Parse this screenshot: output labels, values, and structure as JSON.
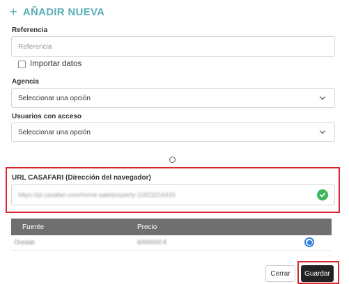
{
  "header": {
    "icon": "plus-icon",
    "title": "AÑADIR NUEVA"
  },
  "form": {
    "referencia": {
      "label": "Referencia",
      "placeholder": "Referencia"
    },
    "importar": {
      "label": "Importar datos",
      "checked": false
    },
    "agencia": {
      "label": "Agencia",
      "value": "Seleccionar una opción"
    },
    "usuarios": {
      "label": "Usuarios con acceso",
      "value": "Seleccionar una opción"
    },
    "url": {
      "label": "URL CASAFARI (Dirección del navegador)",
      "value": "https://pt.casafari.com/home-sale/property-11823216433",
      "status_icon": "check-circle-icon",
      "status_color": "#3eb75a"
    }
  },
  "table": {
    "columns": [
      "Fuente",
      "Precio"
    ],
    "rows": [
      {
        "fuente": "Oredab",
        "precio": "6000000 €",
        "selected": true
      }
    ]
  },
  "buttons": {
    "cancel": "Cerrar",
    "save": "Guardar"
  },
  "colors": {
    "accent": "#5aaeb8",
    "highlight": "#d9262c",
    "radio": "#2f7fd8",
    "table_header": "#6f6f6f"
  }
}
